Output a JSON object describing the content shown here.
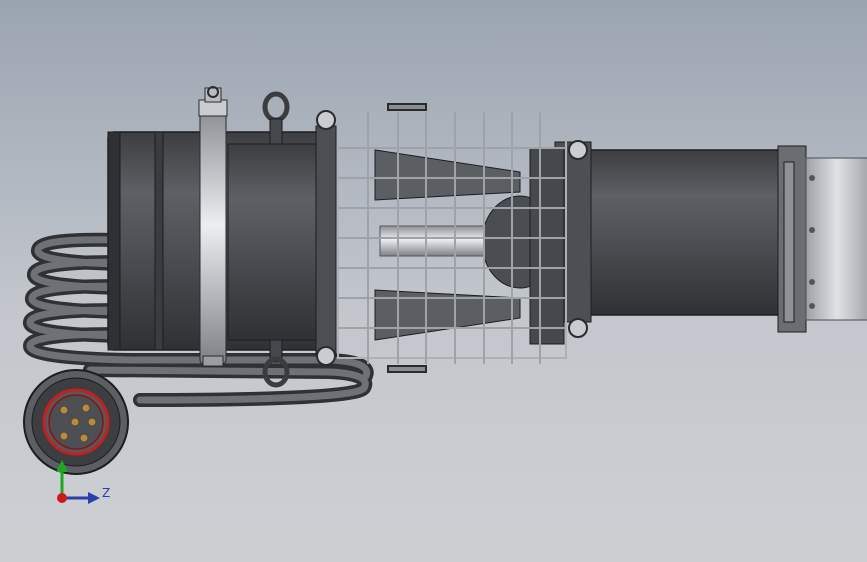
{
  "viewport": {
    "background_top": "#9aa4b1",
    "background_bottom": "#cdd0d3",
    "model_color": "#55585c",
    "connector_ring_color": "#c42020",
    "pin_color": "#b38a4a"
  },
  "triad": {
    "z_label": "Z",
    "z_color": "#2a3fae",
    "y_color": "#1fa81f",
    "origin_color": "#d01818"
  }
}
